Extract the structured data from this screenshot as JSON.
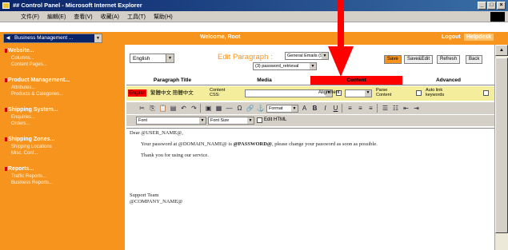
{
  "window": {
    "title": "## Control Panel - Microsoft Internet Explorer",
    "controls": [
      "_",
      "□",
      "×"
    ]
  },
  "menubar": {
    "items": [
      "文件(F)",
      "編輯(E)",
      "查看(V)",
      "收藏(A)",
      "工具(T)",
      "幫助(H)"
    ]
  },
  "header": {
    "nav_select": "Business Management ...",
    "welcome": "Welcome, Root",
    "logout": "Logout",
    "helpdesk": "Helpdesk",
    "bg_color": "#f7941d"
  },
  "sidebar": {
    "sections": [
      {
        "title": "Website...",
        "links": [
          "Columns...",
          "Content Pages..."
        ]
      },
      {
        "title": "Product Management...",
        "links": [
          "Attributes...",
          "Products & Categories..."
        ]
      },
      {
        "title": "Shipping System...",
        "links": [
          "Enquiries...",
          "Orders..."
        ]
      },
      {
        "title": "Shipping Zones...",
        "links": [
          "Shipping Locations",
          "Misc. Conf..."
        ]
      },
      {
        "title": "Reports...",
        "links": [
          "Traffic Reports...",
          "Business Reports..."
        ]
      }
    ]
  },
  "main": {
    "language": "English",
    "edit_label": "Edit Paragraph :",
    "group_select": "General Emails (9)",
    "item_select": "(3) password_retrieval",
    "buttons": {
      "save": "Save",
      "save_edit": "Save&Edit",
      "refresh": "Refresh",
      "back": "Back"
    },
    "tabs": [
      "Paragraph Title",
      "Media",
      "Content",
      "Advanced"
    ],
    "active_tab": "Content",
    "fields": {
      "english": "English",
      "chinese": "繁體中文 簡體中文",
      "content_css": "Content CSS:",
      "alignment": "Alignment",
      "parse_content": "Parse Content",
      "auto_link": "Auto link keywords"
    },
    "toolbar": {
      "format": "Format",
      "font": "Font",
      "font_size": "Font Size",
      "edit_html": "Edit HTML"
    },
    "editor": {
      "greeting": "Dear @USER_NAME@,",
      "body_pre": "Your password at @DOMAIN_NAME@ is ",
      "password_token": "@PASSWORD@",
      "body_post": ", please change your password as soon as possible.",
      "thanks": "Thank you for using our service.",
      "sign_team": "Support Team",
      "sign_company": "@COMPANY_NAME@"
    }
  },
  "annotation": {
    "color": "#ff0000",
    "icon": "red-arrow-down"
  }
}
